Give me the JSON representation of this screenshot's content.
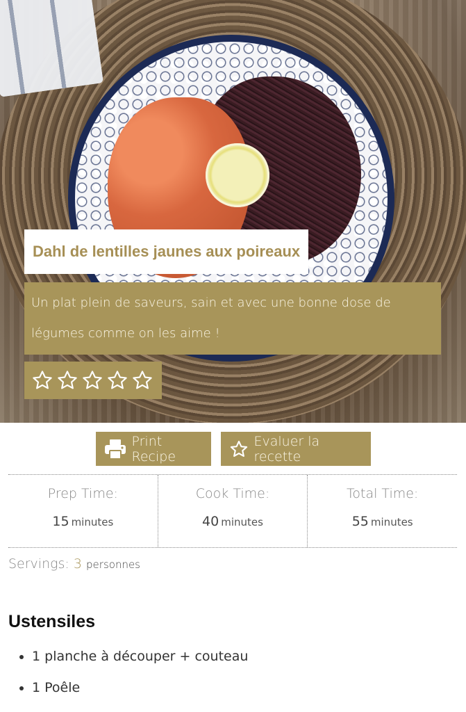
{
  "recipe": {
    "title": "Dahl de lentilles jaunes aux poireaux",
    "summary": "Un plat plein de saveurs, sain et avec une bonne dose de légumes comme on les aime !",
    "rating": {
      "stars_total": 5,
      "stars_filled": 0
    }
  },
  "buttons": {
    "print_label": "Print Recipe",
    "rate_label": "Evaluer la recette"
  },
  "times": [
    {
      "label": "Prep Time:",
      "value": "15",
      "unit": "minutes"
    },
    {
      "label": "Cook Time:",
      "value": "40",
      "unit": "minutes"
    },
    {
      "label": "Total Time:",
      "value": "55",
      "unit": "minutes"
    }
  ],
  "servings": {
    "label": "Servings:",
    "value": "3",
    "unit": "personnes"
  },
  "ustensiles": {
    "title": "Ustensiles",
    "items": [
      "1 planche à découper + couteau",
      "1 Poêle"
    ]
  },
  "colors": {
    "accent": "#a8955a",
    "title_text": "#a68f55",
    "button_text": "#fbf6e6"
  },
  "icons": {
    "print": "printer-icon",
    "rate": "star-outline-icon",
    "rating_star": "star-outline-icon"
  }
}
